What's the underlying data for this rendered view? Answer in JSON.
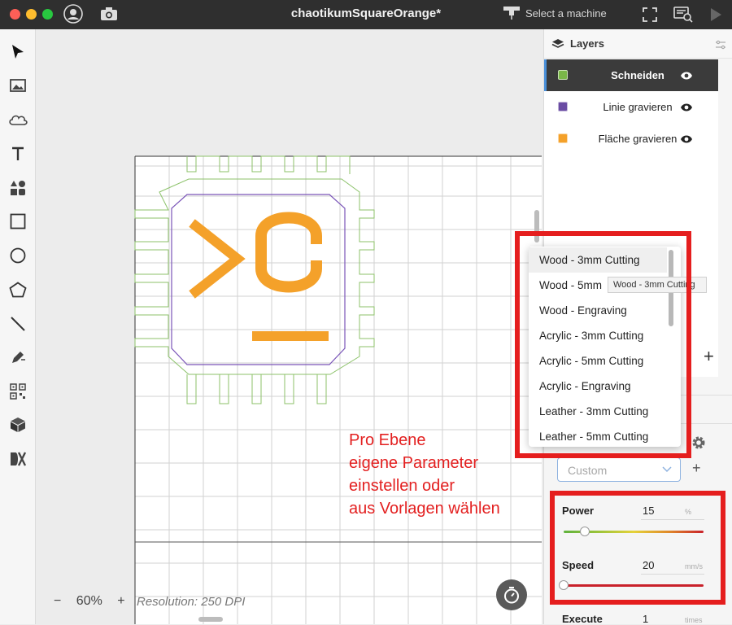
{
  "window": {
    "title": "chaotikumSquareOrange*"
  },
  "titlebar": {
    "machine_label": "Select a machine"
  },
  "toolbar": {
    "tools": [
      "select-tool",
      "image-tool",
      "cloud-tool",
      "text-tool",
      "shapes-tool",
      "rectangle-tool",
      "ellipse-tool",
      "polygon-tool",
      "line-tool",
      "pen-tool",
      "qr-code-tool",
      "3d-box-tool",
      "dxf-import-tool"
    ]
  },
  "canvas": {
    "zoom": "60%",
    "zoom_minus": "−",
    "zoom_plus": "+",
    "resolution": "Resolution: 250 DPI",
    "note_lines": "Pro Ebene\neigene Parameter\neinstellen oder\naus Vorlagen wählen"
  },
  "layers": {
    "title": "Layers",
    "items": [
      {
        "label": "Schneiden",
        "color": "#7ab648"
      },
      {
        "label": "Linie gravieren",
        "color": "#6a4ca3"
      },
      {
        "label": "Fläche gravieren",
        "color": "#f4a12a"
      }
    ],
    "add_label": "+"
  },
  "presets": {
    "items": [
      "Wood - 3mm Cutting",
      "Wood - 5mm Cutting",
      "Wood - Engraving",
      "Acrylic - 3mm Cutting",
      "Acrylic - 5mm Cutting",
      "Acrylic - Engraving",
      "Leather - 3mm Cutting",
      "Leather - 5mm Cutting"
    ],
    "visible_items": [
      "Wood - 3mm Cutting",
      "Wood - 5mm",
      "Wood - Engraving",
      "Acrylic - 3mm Cutting",
      "Acrylic - 5mm Cutting",
      "Acrylic - Engraving",
      "Leather - 3mm Cutting",
      "Leather - 5mm Cutting"
    ],
    "tooltip": "Wood - 3mm Cutting"
  },
  "preset_select": {
    "value": "Custom",
    "add_label": "+"
  },
  "params": {
    "power": {
      "label": "Power",
      "value": "15",
      "unit": "%",
      "fraction": 0.15
    },
    "speed": {
      "label": "Speed",
      "value": "20",
      "unit": "mm/s",
      "fraction": 0.0
    },
    "execute": {
      "label": "Execute",
      "value": "1",
      "unit": "times"
    }
  },
  "colors": {
    "accent": "#4a90d9",
    "highlight": "#e51e1e",
    "logo": "#f4a12a"
  }
}
